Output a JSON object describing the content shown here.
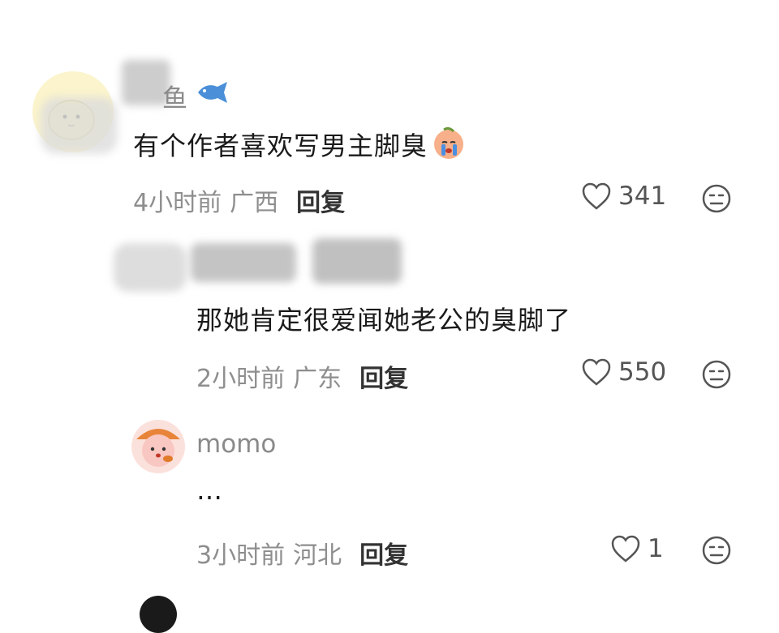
{
  "comments": [
    {
      "username": "鱼",
      "text": "有个作者喜欢写男主脚臭",
      "time": "4小时前",
      "location": "广西",
      "reply_label": "回复",
      "likes": "341",
      "avatar_icon": "cat-avatar",
      "emoji_icon": "crying-peach-emoji",
      "badge_icon": "fish-icon"
    },
    {
      "username": "",
      "text": "那她肯定很爱闻她老公的臭脚了",
      "time": "2小时前",
      "location": "广东",
      "reply_label": "回复",
      "likes": "550"
    },
    {
      "username": "momo",
      "text": "…",
      "time": "3小时前",
      "location": "河北",
      "reply_label": "回复",
      "likes": "1",
      "avatar_icon": "pink-character-avatar"
    }
  ],
  "colors": {
    "text": "#1a1a1a",
    "meta": "#8e8e8e",
    "background": "#ffffff"
  }
}
